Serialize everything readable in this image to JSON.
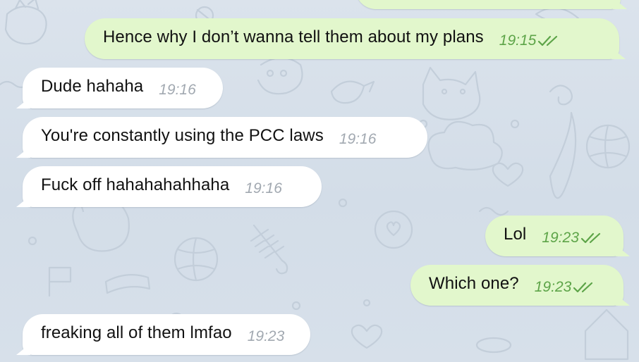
{
  "colors": {
    "background": "#d6dfe9",
    "incoming_bubble": "#ffffff",
    "outgoing_bubble": "#e2f7cc",
    "incoming_time": "#a2a9b1",
    "outgoing_time": "#5da448"
  },
  "messages": [
    {
      "direction": "out",
      "text": "Hence why I don’t wanna tell them about my plans",
      "time": "19:15",
      "status": "read"
    },
    {
      "direction": "in",
      "text": "Dude hahaha",
      "time": "19:16"
    },
    {
      "direction": "in",
      "text": "You're constantly using the PCC laws",
      "time": "19:16"
    },
    {
      "direction": "in",
      "text": "Fuck off hahahahahhaha",
      "time": "19:16"
    },
    {
      "direction": "out",
      "text": "Lol",
      "time": "19:23",
      "status": "read"
    },
    {
      "direction": "out",
      "text": "Which one?",
      "time": "19:23",
      "status": "read"
    },
    {
      "direction": "in",
      "text": "freaking all of them lmfao",
      "time": "19:23"
    }
  ]
}
